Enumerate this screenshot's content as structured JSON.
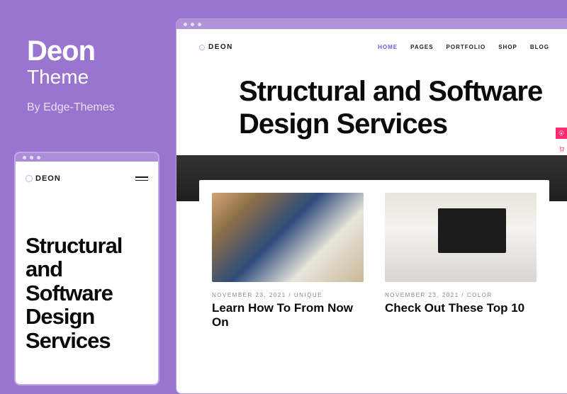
{
  "info": {
    "title": "Deon",
    "subtitle": "Theme",
    "byline": "By Edge-Themes"
  },
  "mobile": {
    "logo": "DEON",
    "heading": "Structural and Software Design Services"
  },
  "desktop": {
    "logo": "DEON",
    "menu": [
      "HOME",
      "PAGES",
      "PORTFOLIO",
      "SHOP",
      "BLOG"
    ],
    "menu_active_index": 0,
    "hero_heading": "Structural and Software Design Services",
    "cards": [
      {
        "date": "NOVEMBER 23, 2021",
        "sep": " / ",
        "tag": "UNIQUE",
        "title": "Learn How To From Now On"
      },
      {
        "date": "NOVEMBER 23, 2021",
        "sep": " / ",
        "tag": "COLOR",
        "title": "Check Out These Top 10"
      }
    ]
  },
  "float": {
    "gear_icon": "gear-icon",
    "cart_icon": "cart-icon"
  },
  "arrow_glyph": "›"
}
